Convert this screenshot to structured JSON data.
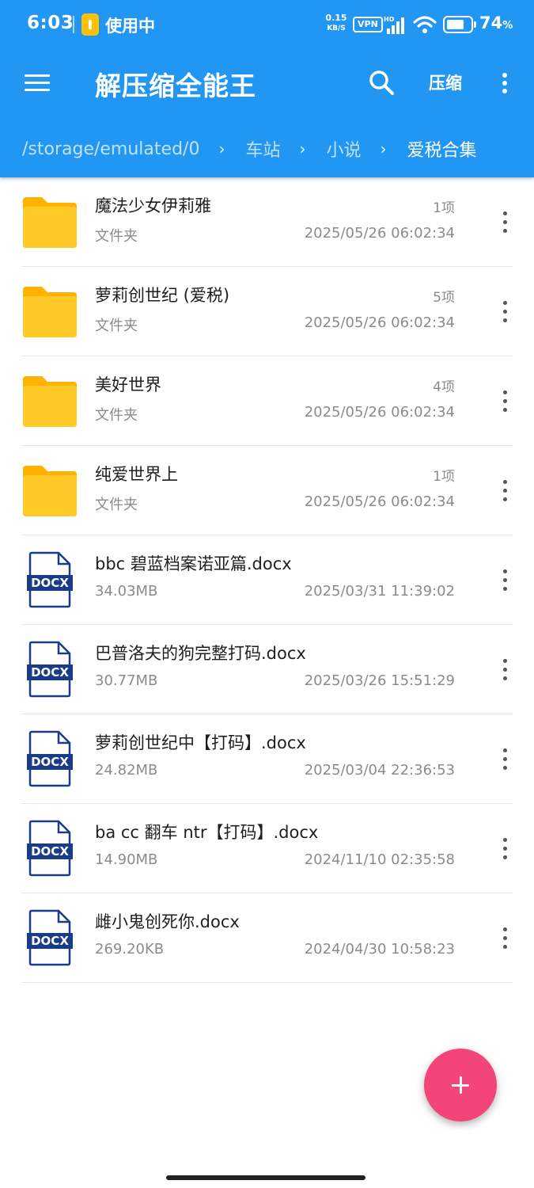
{
  "status_bar": {
    "time": "6:03",
    "in_use": "使用中",
    "speed_value": "0.15",
    "speed_unit": "KB/S",
    "vpn": "VPN",
    "network_hd": "HD",
    "battery_percent": 74,
    "battery_text": "74",
    "battery_unit": "%"
  },
  "toolbar": {
    "title": "解压缩全能王",
    "compress_label": "压缩",
    "icons": [
      "menu-icon",
      "search-icon",
      "more-vert-icon"
    ]
  },
  "breadcrumb": {
    "items": [
      "/storage/emulated/0",
      "车站",
      "小说",
      "爱税合集"
    ],
    "separator": "›"
  },
  "files": [
    {
      "name": "魔法少女伊莉雅",
      "type": "folder",
      "sub": "文件夹",
      "count": "1项",
      "date": "2025/05/26 06:02:34"
    },
    {
      "name": "萝莉创世纪 (爱税)",
      "type": "folder",
      "sub": "文件夹",
      "count": "5项",
      "date": "2025/05/26 06:02:34"
    },
    {
      "name": "美好世界",
      "type": "folder",
      "sub": "文件夹",
      "count": "4项",
      "date": "2025/05/26 06:02:34"
    },
    {
      "name": "纯爱世界上",
      "type": "folder",
      "sub": "文件夹",
      "count": "1项",
      "date": "2025/05/26 06:02:34"
    },
    {
      "name": "bbc 碧蓝档案诺亚篇.docx",
      "type": "docx",
      "sub": "34.03MB",
      "count": "",
      "date": "2025/03/31 11:39:02"
    },
    {
      "name": "巴普洛夫的狗完整打码.docx",
      "type": "docx",
      "sub": "30.77MB",
      "count": "",
      "date": "2025/03/26 15:51:29"
    },
    {
      "name": "萝莉创世纪中【打码】.docx",
      "type": "docx",
      "sub": "24.82MB",
      "count": "",
      "date": "2025/03/04 22:36:53"
    },
    {
      "name": "ba cc 翻车 ntr【打码】.docx",
      "type": "docx",
      "sub": "14.90MB",
      "count": "",
      "date": "2024/11/10 02:35:58"
    },
    {
      "name": "雌小鬼创死你.docx",
      "type": "docx",
      "sub": "269.20KB",
      "count": "",
      "date": "2024/04/30 10:58:23"
    }
  ],
  "docx_badge": "DOCX",
  "colors": {
    "primary": "#2196f3",
    "fab": "#f4457a",
    "folder": "#ffca28",
    "docx": "#1a3a8a"
  }
}
